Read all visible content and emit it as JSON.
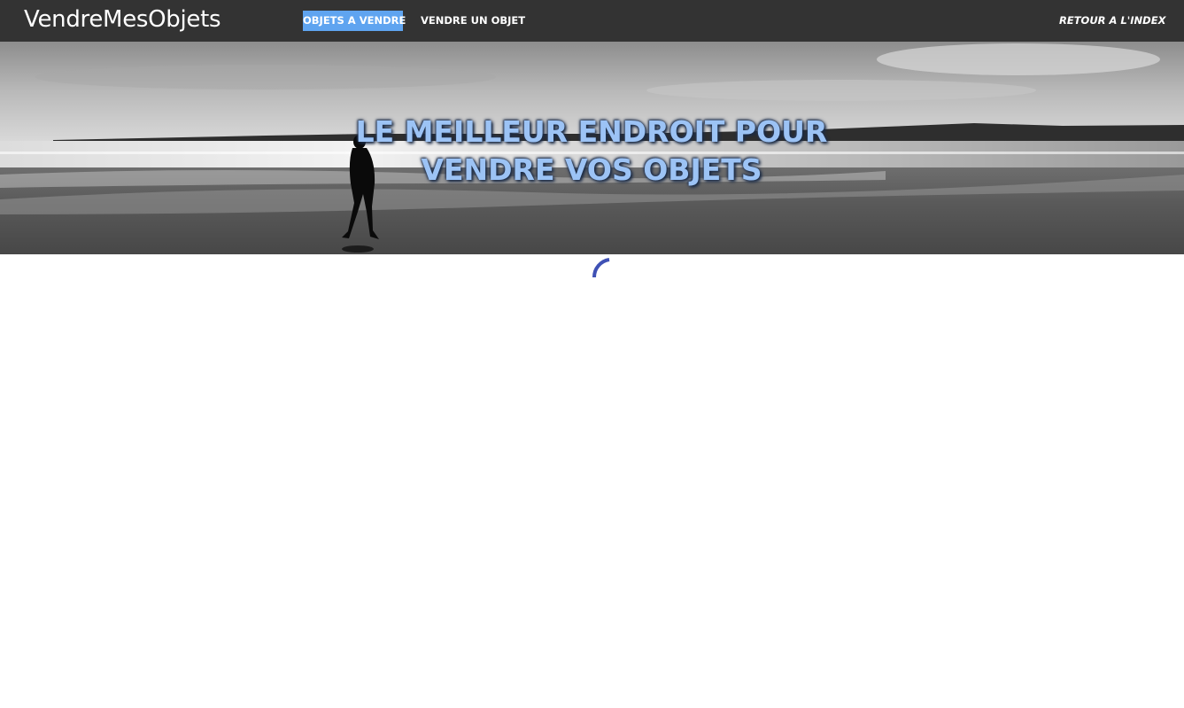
{
  "navbar": {
    "brand": "VendreMesObjets",
    "items": [
      {
        "label": "OBJETS A VENDRE",
        "active": true
      },
      {
        "label": "VENDRE UN OBJET",
        "active": false
      }
    ],
    "back_link": "RETOUR A L'INDEX"
  },
  "hero": {
    "title_line1": "LE MEILLEUR ENDROIT POUR",
    "title_line2": "VENDRE VOS OBJETS",
    "image": "black-and-white beach photo with walking silhouette"
  },
  "loading": {
    "icon": "loading-spinner-icon"
  },
  "colors": {
    "navbar_bg": "#333333",
    "active_tab_bg": "#5fa4f0",
    "hero_title": "#9cc3f5",
    "spinner": "#3f51b5"
  }
}
